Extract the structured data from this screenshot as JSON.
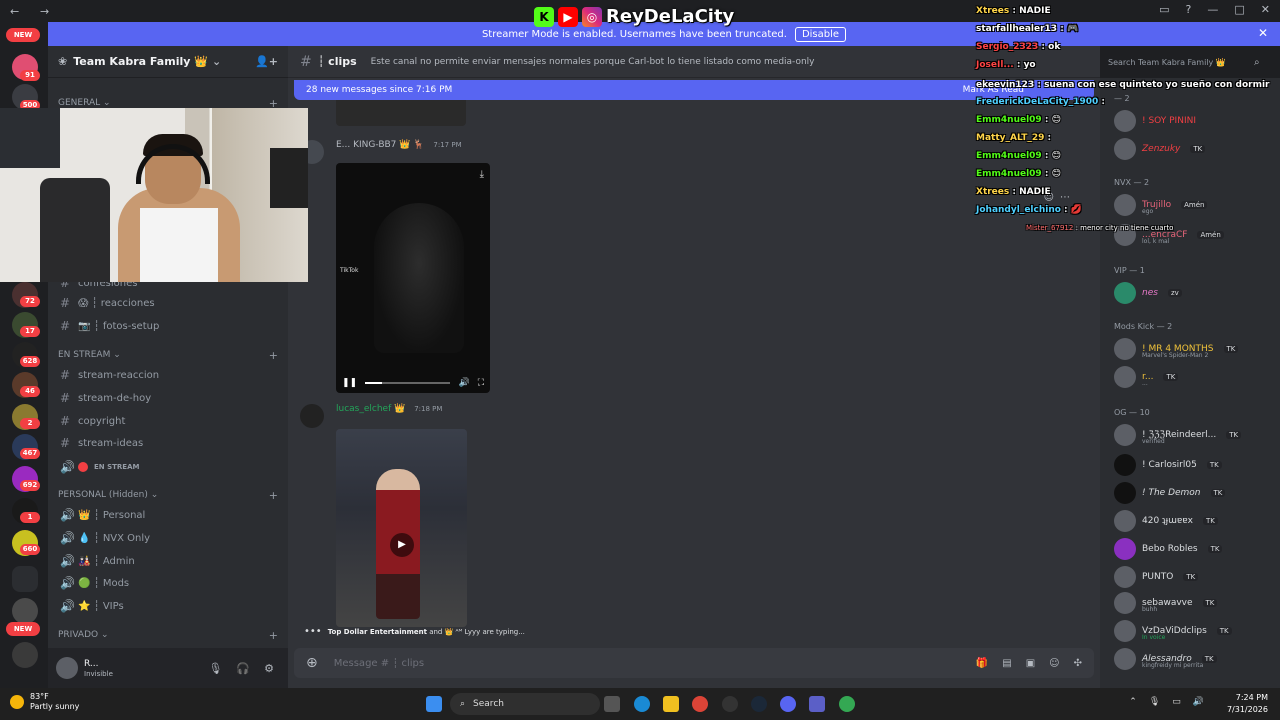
{
  "brand": {
    "name": "ReyDeLaCity",
    "overlay_faded_text": "Team Kabra Famil"
  },
  "banner": {
    "text": "Streamer Mode is enabled. Usernames have been truncated.",
    "button": "Disable"
  },
  "rail": {
    "new_top": "NEW",
    "new_bottom": "NEW",
    "badges": [
      "91",
      "500",
      "72",
      "17",
      "628",
      "46",
      "2",
      "467",
      "692",
      "1",
      "660"
    ]
  },
  "server": {
    "name": "Team Kabra Family 👑"
  },
  "sidebar": {
    "categories": {
      "general": "GENERAL",
      "en_stream": "EN STREAM",
      "personal": "PERSONAL (Hidden)",
      "privado": "PRIVADO"
    },
    "channels": [
      {
        "label": "confesiones"
      },
      {
        "label": "😱 ┆ reacciones"
      },
      {
        "label": "📷 ┆ fotos-setup"
      },
      {
        "label": "stream-reaccion"
      },
      {
        "label": "stream-de-hoy"
      },
      {
        "label": "copyright"
      },
      {
        "label": "stream-ideas"
      },
      {
        "label": "EN STREAM"
      },
      {
        "label": "👑 ┆ Personal"
      },
      {
        "label": "💧 ┆ NVX Only"
      },
      {
        "label": "🎎 ┆ Admin"
      },
      {
        "label": "🟢 ┆ Mods"
      },
      {
        "label": "⭐ ┆ VIPs"
      }
    ]
  },
  "user": {
    "name": "R...",
    "status": "Invisible"
  },
  "channel": {
    "name": "┆ clips",
    "topic": "Este canal no permite enviar mensajes normales porque Carl-bot lo tiene listado como media-only"
  },
  "newbar": {
    "text": "28 new messages since 7:16 PM",
    "action": "Mark As Read"
  },
  "messages": [
    {
      "author": "E... KING-BB7 👑 🦌",
      "time": "7:17 PM",
      "watermark": "TikTok"
    },
    {
      "author": "lucas_elchef 👑",
      "time": "7:18 PM"
    }
  ],
  "typing": {
    "names": "Top Dollar Entertainment",
    "rest": " and 👑 ᴬᴹ Lyyy are typing..."
  },
  "composer": {
    "placeholder": "Message # ┆ clips"
  },
  "members": {
    "search_placeholder": "Search Team Kabra Family 👑",
    "groups": [
      {
        "title": "NVX — 2",
        "items": [
          {
            "name": "Trujillo",
            "tag": "Amén",
            "sub": "ego"
          },
          {
            "name": "...encraCF",
            "tag": "Amén",
            "sub": "lol, k mal"
          }
        ]
      },
      {
        "title": "VIP — 1",
        "items": [
          {
            "name": "nes",
            "tag": "zv",
            "sub": ""
          }
        ]
      },
      {
        "title": "Mods Kick — 2",
        "items": [
          {
            "name": "! MR 4 MONTHS",
            "tag": "TK",
            "sub": "Marvel's Spider-Man 2"
          },
          {
            "name": "r...",
            "tag": "TK",
            "sub": "..."
          }
        ]
      },
      {
        "title": "OG — 10",
        "items": [
          {
            "name": "! ℨℨℨReindeerl...",
            "tag": "TK",
            "sub": "verified"
          },
          {
            "name": "! Carlosirl05",
            "tag": "TK",
            "sub": ""
          },
          {
            "name": "! The Demon",
            "tag": "TK",
            "sub": ""
          },
          {
            "name": "420 ʇɟɯɐɐx",
            "tag": "TK",
            "sub": ""
          },
          {
            "name": "Bebo Robles",
            "tag": "TK",
            "sub": ""
          },
          {
            "name": "PUNTO",
            "tag": "TK",
            "sub": ""
          },
          {
            "name": "sebawavve",
            "tag": "TK",
            "sub": "buhh"
          },
          {
            "name": "VzDaViDdclips",
            "tag": "TK",
            "sub": "In voice"
          },
          {
            "name": "Alessandro",
            "tag": "TK",
            "sub": "kingfreidy mi perrita"
          }
        ]
      },
      {
        "title": "— 2",
        "items": [
          {
            "name": "! SOY PININI",
            "tag": "",
            "sub": ""
          },
          {
            "name": "Zenzuky",
            "tag": "TK",
            "sub": ""
          }
        ]
      }
    ]
  },
  "chat": [
    {
      "user": "Xtrees",
      "msg": "NADIE",
      "color": "#ffd54a"
    },
    {
      "user": "starfallhealer13",
      "msg": "🎮",
      "color": "#ffffff"
    },
    {
      "user": "Sergio_2323",
      "msg": "ok",
      "color": "#ff4444"
    },
    {
      "user": "JoseIl...",
      "msg": "yo",
      "color": "#ff4444"
    },
    {
      "user": "ekeevin123",
      "msg": "suena con ese quinteto yo sueño con dormir",
      "color": "#ffffff"
    },
    {
      "user": "FrederickDeLaCity_1900",
      "msg": "",
      "color": "#4fd0ff"
    },
    {
      "user": "Emm4nuel09",
      "msg": "😊",
      "color": "#53fc18"
    },
    {
      "user": "Matty_ALT_29",
      "msg": "",
      "color": "#ffd54a"
    },
    {
      "user": "Emm4nuel09",
      "msg": "😊",
      "color": "#53fc18"
    },
    {
      "user": "Emm4nuel09",
      "msg": "😊",
      "color": "#53fc18"
    },
    {
      "user": "Xtrees",
      "msg": "NADIE",
      "color": "#ffd54a"
    },
    {
      "user": "Johandyl_elchino",
      "msg": "💋",
      "color": "#4fd0ff"
    },
    {
      "user": "Mister_67912",
      "msg": "menor city no tiene cuarto",
      "color": "#ff6b6b"
    }
  ],
  "taskbar": {
    "temp": "83°F",
    "weather": "Partly sunny",
    "search": "Search",
    "time": "7:24 PM",
    "date": "7/31/2026"
  }
}
